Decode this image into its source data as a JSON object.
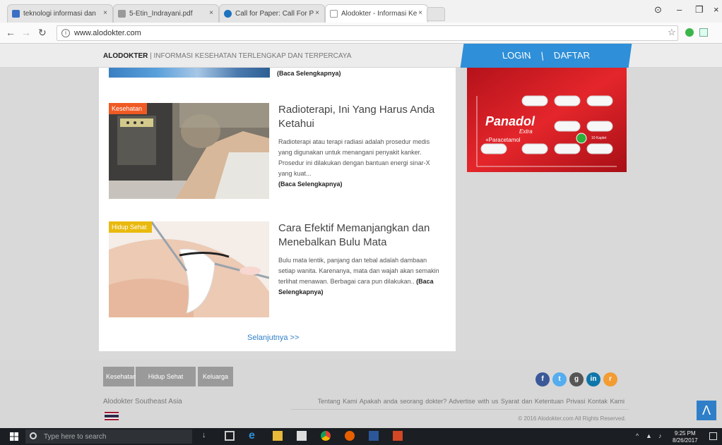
{
  "browser": {
    "tabs": [
      {
        "label": "teknologi informasi dan",
        "active": false,
        "favicon_color": "#3b6fc4"
      },
      {
        "label": "5-Etin_Indrayani.pdf",
        "active": false,
        "favicon_color": "#999999"
      },
      {
        "label": "Call for Paper: Call For P",
        "active": false,
        "favicon_color": "#1e73be"
      },
      {
        "label": "Alodokter - Informasi Ke",
        "active": true,
        "favicon_color": "#999999"
      }
    ],
    "tab_close": "×",
    "url": "www.alodokter.com",
    "controls": {
      "minimize": "–",
      "maximize": "❐",
      "close": "×"
    }
  },
  "site": {
    "brand": "ALODOKTER",
    "separator": "|",
    "tagline": "INFORMASI KESEHATAN TERLENGKAP DAN TERPERCAYA",
    "login": "LOGIN",
    "register": "DAFTAR"
  },
  "content": {
    "top_readmore": "(Baca Selengkapnya)",
    "articles": [
      {
        "category": "Kesehatan",
        "title": "Radioterapi, Ini Yang Harus Anda Ketahui",
        "excerpt": "Radioterapi atau terapi radiasi adalah prosedur medis yang digunakan untuk menangani penyakit kanker. Prosedur ini dilakukan dengan bantuan energi sinar-X yang kuat...",
        "readmore": "(Baca Selengkapnya)"
      },
      {
        "category": "Hidup Sehat",
        "title": "Cara Efektif Memanjangkan dan Menebalkan Bulu Mata",
        "excerpt": "Bulu mata lentik, panjang dan tebal adalah dambaan setiap wanita. Karenanya, mata dan wajah akan semakin terlihat menawan. Berbagai cara pun dilakukan..",
        "readmore": "(Baca Selengkapnya)"
      }
    ],
    "next": "Selanjutnya >>"
  },
  "ad": {
    "brand": "Panadol",
    "sub": "Extra",
    "ingredient": "+Paracetamol",
    "caption": "10 Kaplet"
  },
  "footer": {
    "categories": [
      "Kesehatan",
      "Hidup Sehat",
      "Keluarga"
    ],
    "region": "Alodokter Southeast Asia",
    "links": [
      "Tentang Kami",
      "Apakah anda seorang dokter?",
      "Advertise with us",
      "Syarat dan Ketentuan",
      "Privasi",
      "Kontak Kami"
    ],
    "copyright": "© 2016 Alodokter.com All Rights Reserved.",
    "social": [
      {
        "icon": "facebook-icon",
        "glyph": "f",
        "color": "#3b5998"
      },
      {
        "icon": "twitter-icon",
        "glyph": "t",
        "color": "#55acee"
      },
      {
        "icon": "google-plus-icon",
        "glyph": "g",
        "color": "#555555"
      },
      {
        "icon": "linkedin-icon",
        "glyph": "in",
        "color": "#0e76a8"
      },
      {
        "icon": "rss-icon",
        "glyph": "r",
        "color": "#f39c33"
      }
    ],
    "scroll_top": "Λ"
  },
  "taskbar": {
    "search_placeholder": "Type here to search",
    "time": "9:25 PM",
    "date": "8/26/2017"
  }
}
